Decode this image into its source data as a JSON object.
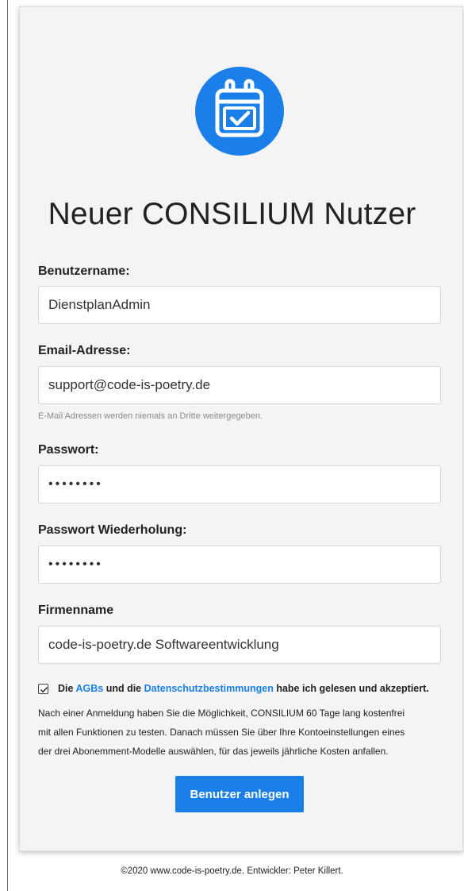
{
  "title": "Neuer CONSILIUM Nutzer",
  "logo_icon": "calendar-check-icon",
  "accent_color": "#1a7fe8",
  "fields": {
    "username": {
      "label": "Benutzername:",
      "value": "DienstplanAdmin"
    },
    "email": {
      "label": "Email-Adresse:",
      "value": "support@code-is-poetry.de",
      "help": "E-Mail Adressen werden niemals an Dritte weitergegeben."
    },
    "password": {
      "label": "Passwort:",
      "value": "••••••••"
    },
    "password_repeat": {
      "label": "Passwort Wiederholung:",
      "value": "••••••••"
    },
    "company": {
      "label": "Firmenname",
      "value": "code-is-poetry.de Softwareentwicklung"
    }
  },
  "agreement": {
    "checked": true,
    "prefix": "Die",
    "agbs_link": "AGBs",
    "middle": "und die",
    "privacy_link": "Datenschutzbestimmungen",
    "suffix": "habe ich gelesen und akzeptiert."
  },
  "note_lines": [
    "Nach einer Anmeldung haben Sie die Möglichkeit, CONSILIUM 60 Tage lang kostenfrei",
    "mit allen Funktionen zu testen. Danach müssen Sie über Ihre Kontoeinstellungen eines",
    "der drei Abonemment-Modelle auswählen, für das jeweils jährliche Kosten anfallen."
  ],
  "submit_label": "Benutzer anlegen",
  "footer": "©2020 www.code-is-poetry.de. Entwickler: Peter Killert."
}
